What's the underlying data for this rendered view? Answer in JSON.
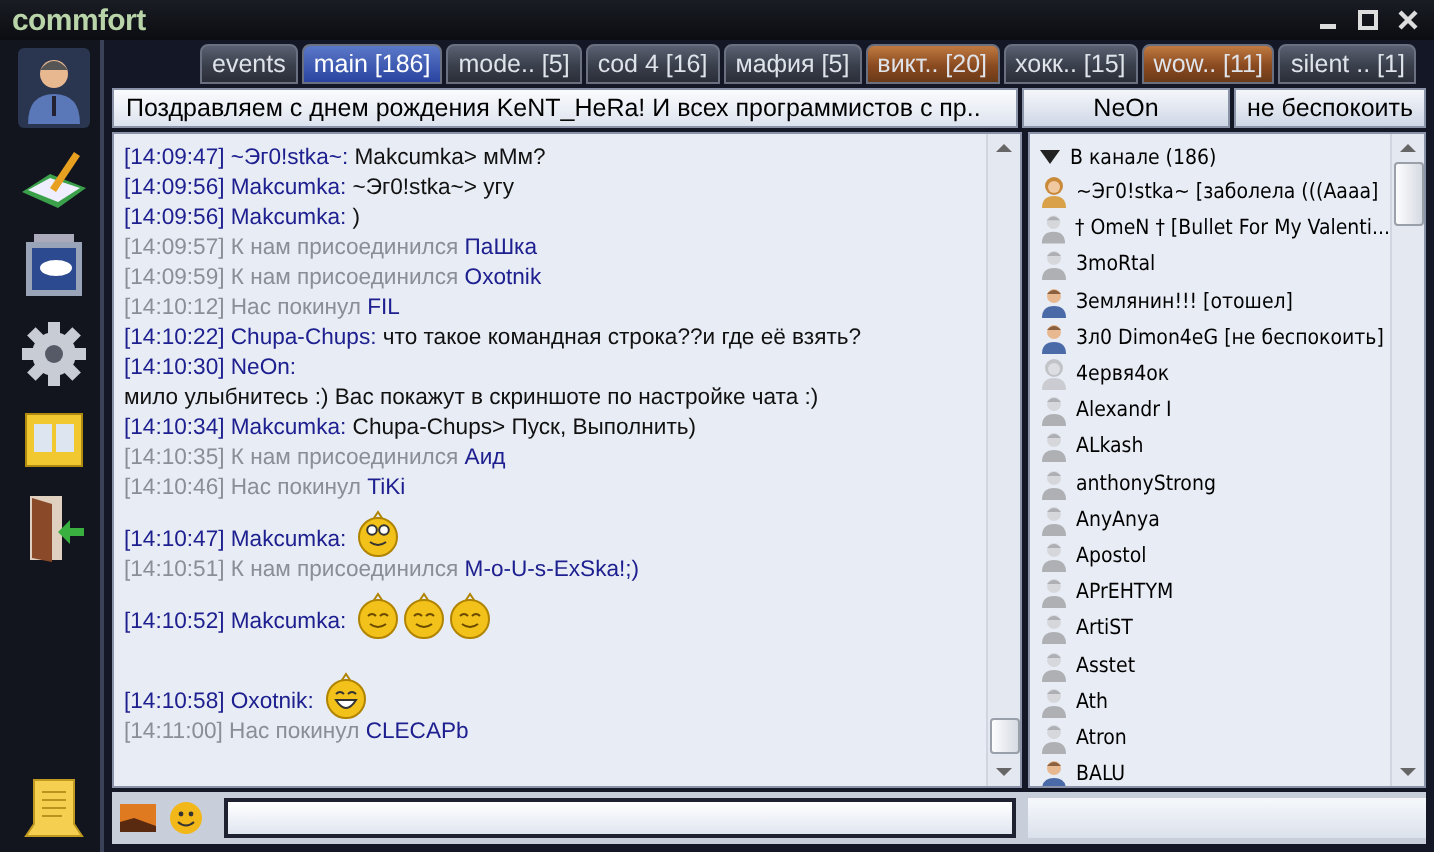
{
  "window": {
    "title": "commfort"
  },
  "tabs": [
    {
      "label": "events",
      "selected": false,
      "highlighted": false
    },
    {
      "label": "main [186]",
      "selected": true,
      "highlighted": false
    },
    {
      "label": "mode.. [5]",
      "selected": false,
      "highlighted": false
    },
    {
      "label": "cod 4 [16]",
      "selected": false,
      "highlighted": false
    },
    {
      "label": "мафия [5]",
      "selected": false,
      "highlighted": false
    },
    {
      "label": "викт.. [20]",
      "selected": false,
      "highlighted": true
    },
    {
      "label": "хокк.. [15]",
      "selected": false,
      "highlighted": false
    },
    {
      "label": "wow.. [11]",
      "selected": false,
      "highlighted": true
    },
    {
      "label": "silent .. [1]",
      "selected": false,
      "highlighted": false
    }
  ],
  "topic": "Поздравляем с днем рождения KeNT_HeRa! И всех программистов с пр..",
  "nick_button": "NeOn",
  "status_button": "не беспокоить",
  "messages": [
    {
      "kind": "message",
      "time": "[14:09:47]",
      "nick": "~Эг0!stka~:",
      "text": "Makcumka> мМм?"
    },
    {
      "kind": "message",
      "time": "[14:09:56]",
      "nick": "Makcumka:",
      "text": "~Эг0!stka~> угу"
    },
    {
      "kind": "message",
      "time": "[14:09:56]",
      "nick": "Makcumka:",
      "text": ")"
    },
    {
      "kind": "event",
      "time": "[14:09:57]",
      "text": "К нам присоединился",
      "nick": "ПаШка"
    },
    {
      "kind": "event",
      "time": "[14:09:59]",
      "text": "К нам присоединился",
      "nick": "Oxotnik"
    },
    {
      "kind": "event",
      "time": "[14:10:12]",
      "text": "Нас покинул",
      "nick": "FIL"
    },
    {
      "kind": "message",
      "time": "[14:10:22]",
      "nick": "Chupa-Chups:",
      "text": "что такое командная строка??и где её взять?"
    },
    {
      "kind": "message_break",
      "time": "[14:10:30]",
      "nick": "NeOn:",
      "text": "мило улыбнитесь :) Вас покажут в скриншоте по настройке чата :)"
    },
    {
      "kind": "message",
      "time": "[14:10:34]",
      "nick": "Makcumka:",
      "text": "Chupa-Chups> Пуск, Выполнить)"
    },
    {
      "kind": "event",
      "time": "[14:10:35]",
      "text": "К нам присоединился",
      "nick": "Аид"
    },
    {
      "kind": "event",
      "time": "[14:10:46]",
      "text": "Нас покинул",
      "nick": "TiKi"
    },
    {
      "kind": "smileys",
      "time": "[14:10:47]",
      "nick": "Makcumka:",
      "smileys": [
        {
          "kind": "wink"
        }
      ]
    },
    {
      "kind": "event",
      "time": "[14:10:51]",
      "text": "К нам присоединился",
      "nick": "M-o-U-s-ExSka!;)"
    },
    {
      "kind": "smileys",
      "time": "[14:10:52]",
      "nick": "Makcumka:",
      "smileys": [
        {
          "kind": "content"
        },
        {
          "kind": "content"
        },
        {
          "kind": "content"
        }
      ]
    },
    {
      "kind": "smileys",
      "time": "[14:10:58]",
      "nick": "Oxotnik:",
      "smileys": [
        {
          "kind": "laugh"
        }
      ]
    },
    {
      "kind": "event",
      "time": "[14:11:00]",
      "text": "Нас покинул",
      "nick": "CLECAPb"
    }
  ],
  "userlist": {
    "header": "В канале (186)",
    "expanded": true,
    "users": [
      {
        "name": "~Эг0!stka~ [заболела (((Аааа]",
        "kind": "female",
        "dimmed": false
      },
      {
        "name": "† OmeN † [Bullet For My Valenti...",
        "kind": "male",
        "dimmed": true
      },
      {
        "name": "3moRtal",
        "kind": "male",
        "dimmed": true
      },
      {
        "name": "Землянин!!! [отошел]",
        "kind": "male",
        "dimmed": false
      },
      {
        "name": "3л0 Dimon4eG [не беспокоить]",
        "kind": "male",
        "dimmed": false
      },
      {
        "name": "4ервя4ок",
        "kind": "female",
        "dimmed": true
      },
      {
        "name": "Alexandr I",
        "kind": "male",
        "dimmed": true
      },
      {
        "name": "ALkash",
        "kind": "male",
        "dimmed": true
      },
      {
        "name": "anthonyStrong",
        "kind": "male",
        "dimmed": true
      },
      {
        "name": "AnyAnya",
        "kind": "male",
        "dimmed": true
      },
      {
        "name": "Apostol",
        "kind": "male",
        "dimmed": true
      },
      {
        "name": "APrEHTYM",
        "kind": "male",
        "dimmed": true
      },
      {
        "name": "ArtiST",
        "kind": "male",
        "dimmed": true
      },
      {
        "name": "Asstet",
        "kind": "male",
        "dimmed": true
      },
      {
        "name": "Ath",
        "kind": "male",
        "dimmed": true
      },
      {
        "name": "Atron",
        "kind": "male",
        "dimmed": true
      },
      {
        "name": "BALU",
        "kind": "male",
        "dimmed": false
      }
    ]
  }
}
